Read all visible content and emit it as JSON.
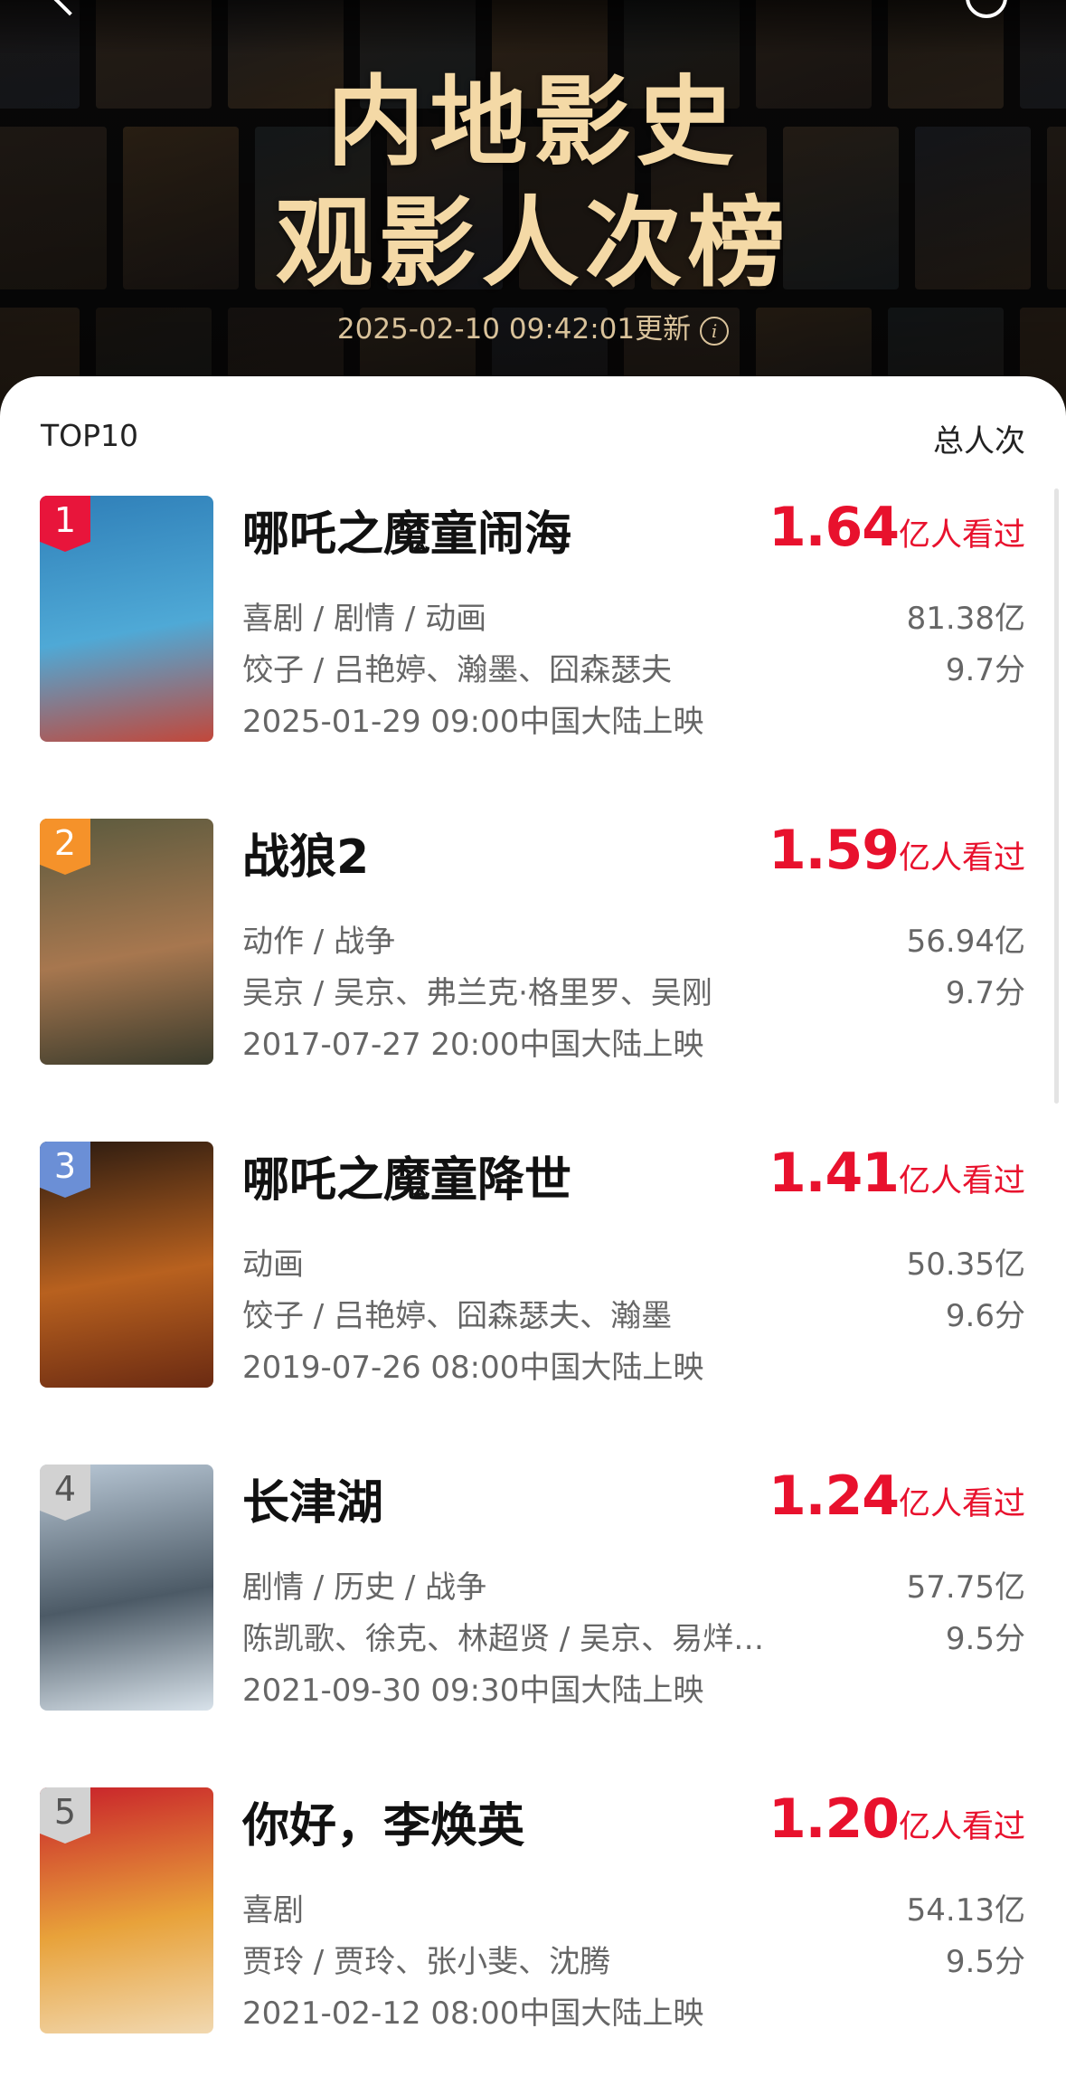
{
  "header": {
    "title_line1": "内地影史",
    "title_line2": "观影人次榜",
    "update_time": "2025-02-10 09:42:01更新",
    "info_icon": "info-icon",
    "back_icon": "back-chevron-icon",
    "top_right_icon": "circle-icon"
  },
  "list": {
    "heading": "TOP10",
    "column_label": "总人次",
    "viewer_unit": "亿人看过",
    "movies": [
      {
        "rank": "1",
        "title": "哪吒之魔童闹海",
        "viewers": "1.64",
        "genre": "喜剧 / 剧情 / 动画",
        "cast": "饺子 / 吕艳婷、瀚墨、囧森瑟夫",
        "release": "2025-01-29 09:00中国大陆上映",
        "box_office": "81.38亿",
        "score": "9.7分",
        "badge_color": "#e8153b",
        "poster_colors": [
          "#2f7fb8",
          "#4fa9d6",
          "#c2473a"
        ]
      },
      {
        "rank": "2",
        "title": "战狼2",
        "viewers": "1.59",
        "genre": "动作 / 战争",
        "cast": "吴京 / 吴京、弗兰克·格里罗、吴刚",
        "release": "2017-07-27 20:00中国大陆上映",
        "box_office": "56.94亿",
        "score": "9.7分",
        "badge_color": "#f5922a",
        "poster_colors": [
          "#5b5a3e",
          "#a7774f",
          "#3a3b2c"
        ]
      },
      {
        "rank": "3",
        "title": "哪吒之魔童降世",
        "viewers": "1.41",
        "genre": "动画",
        "cast": "饺子 / 吕艳婷、囧森瑟夫、瀚墨",
        "release": "2019-07-26 08:00中国大陆上映",
        "box_office": "50.35亿",
        "score": "9.6分",
        "badge_color": "#6b8fd6",
        "poster_colors": [
          "#2a1a10",
          "#b8611f",
          "#6a2a12"
        ]
      },
      {
        "rank": "4",
        "title": "长津湖",
        "viewers": "1.24",
        "genre": "剧情 / 历史 / 战争",
        "cast": "陈凯歌、徐克、林超贤 / 吴京、易烊千玺、段奕宏",
        "release": "2021-09-30 09:30中国大陆上映",
        "box_office": "57.75亿",
        "score": "9.5分",
        "badge_color": "#d2d2d2",
        "poster_colors": [
          "#b9c8d6",
          "#4c5a66",
          "#d8e2ea"
        ]
      },
      {
        "rank": "5",
        "title": "你好，李焕英",
        "viewers": "1.20",
        "genre": "喜剧",
        "cast": "贾玲 / 贾玲、张小斐、沈腾",
        "release": "2021-02-12 08:00中国大陆上映",
        "box_office": "54.13亿",
        "score": "9.5分",
        "badge_color": "#d2d2d2",
        "poster_colors": [
          "#c8202a",
          "#e8a23a",
          "#f1d8b0"
        ]
      }
    ]
  }
}
